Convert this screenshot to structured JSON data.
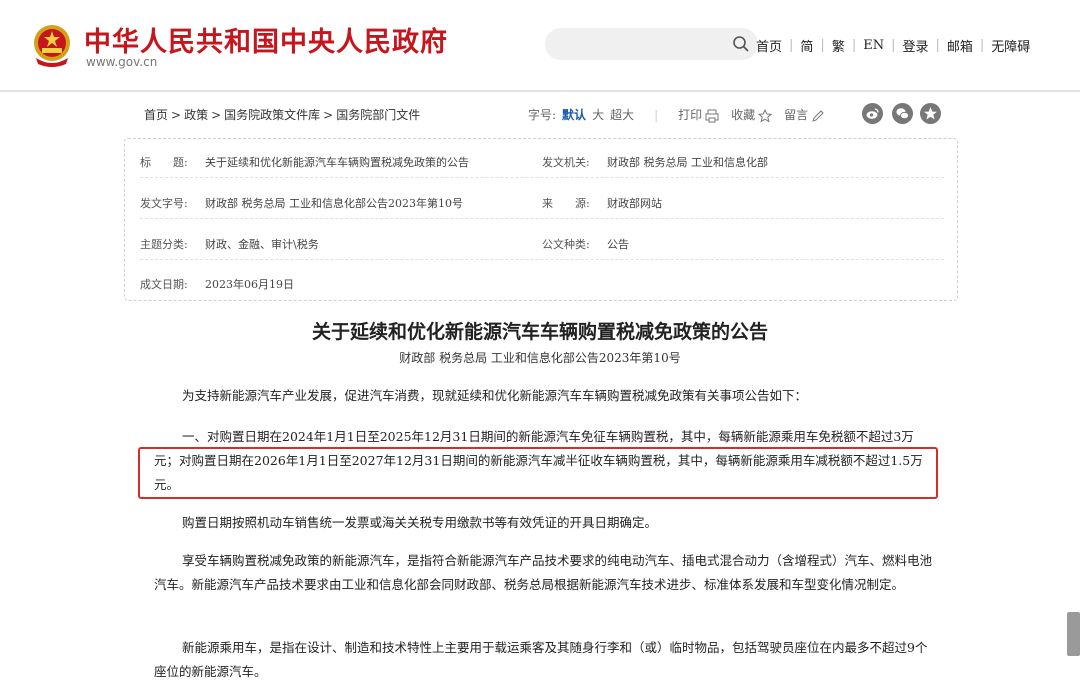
{
  "header": {
    "site_title": "中华人民共和国中央人民政府",
    "site_url": "www.gov.cn",
    "nav": [
      "首页",
      "简",
      "繁",
      "EN",
      "登录",
      "邮箱",
      "无障碍"
    ]
  },
  "breadcrumb": [
    "首页",
    "政策",
    "国务院政策文件库",
    "国务院部门文件"
  ],
  "tools": {
    "font_size_label": "字号:",
    "font_sizes": [
      "默认",
      "大",
      "超大"
    ],
    "print": "打印",
    "favorite": "收藏",
    "comment": "留言"
  },
  "share_icons": [
    "weibo-icon",
    "wechat-icon",
    "qzone-icon"
  ],
  "info": {
    "title_label": "标　　题:",
    "title": "关于延续和优化新能源汽车车辆购置税减免政策的公告",
    "issuer_label": "发文机关:",
    "issuer": "财政部 税务总局 工业和信息化部",
    "doc_no_label": "发文字号:",
    "doc_no": "财政部 税务总局 工业和信息化部公告2023年第10号",
    "source_label": "来　　源:",
    "source": "财政部网站",
    "category_label": "主题分类:",
    "category": "财政、金融、审计\\税务",
    "doc_type_label": "公文种类:",
    "doc_type": "公告",
    "date_label": "成文日期:",
    "date": "2023年06月19日"
  },
  "article": {
    "title": "关于延续和优化新能源汽车车辆购置税减免政策的公告",
    "subtitle": "财政部 税务总局 工业和信息化部公告2023年第10号",
    "paragraphs": [
      "为支持新能源汽车产业发展，促进汽车消费，现就延续和优化新能源汽车车辆购置税减免政策有关事项公告如下：",
      "一、对购置日期在2024年1月1日至2025年12月31日期间的新能源汽车免征车辆购置税，其中，每辆新能源乘用车免税额不超过3万元；对购置日期在2026年1月1日至2027年12月31日期间的新能源汽车减半征收车辆购置税，其中，每辆新能源乘用车减税额不超过1.5万元。",
      "购置日期按照机动车销售统一发票或海关关税专用缴款书等有效凭证的开具日期确定。",
      "享受车辆购置税减免政策的新能源汽车，是指符合新能源汽车产品技术要求的纯电动汽车、插电式混合动力（含增程式）汽车、燃料电池汽车。新能源汽车产品技术要求由工业和信息化部会同财政部、税务总局根据新能源汽车技术进步、标准体系发展和车型变化情况制定。",
      "新能源乘用车，是指在设计、制造和技术特性上主要用于载运乘客及其随身行李和（或）临时物品，包括驾驶员座位在内最多不超过9个座位的新能源汽车。"
    ]
  }
}
